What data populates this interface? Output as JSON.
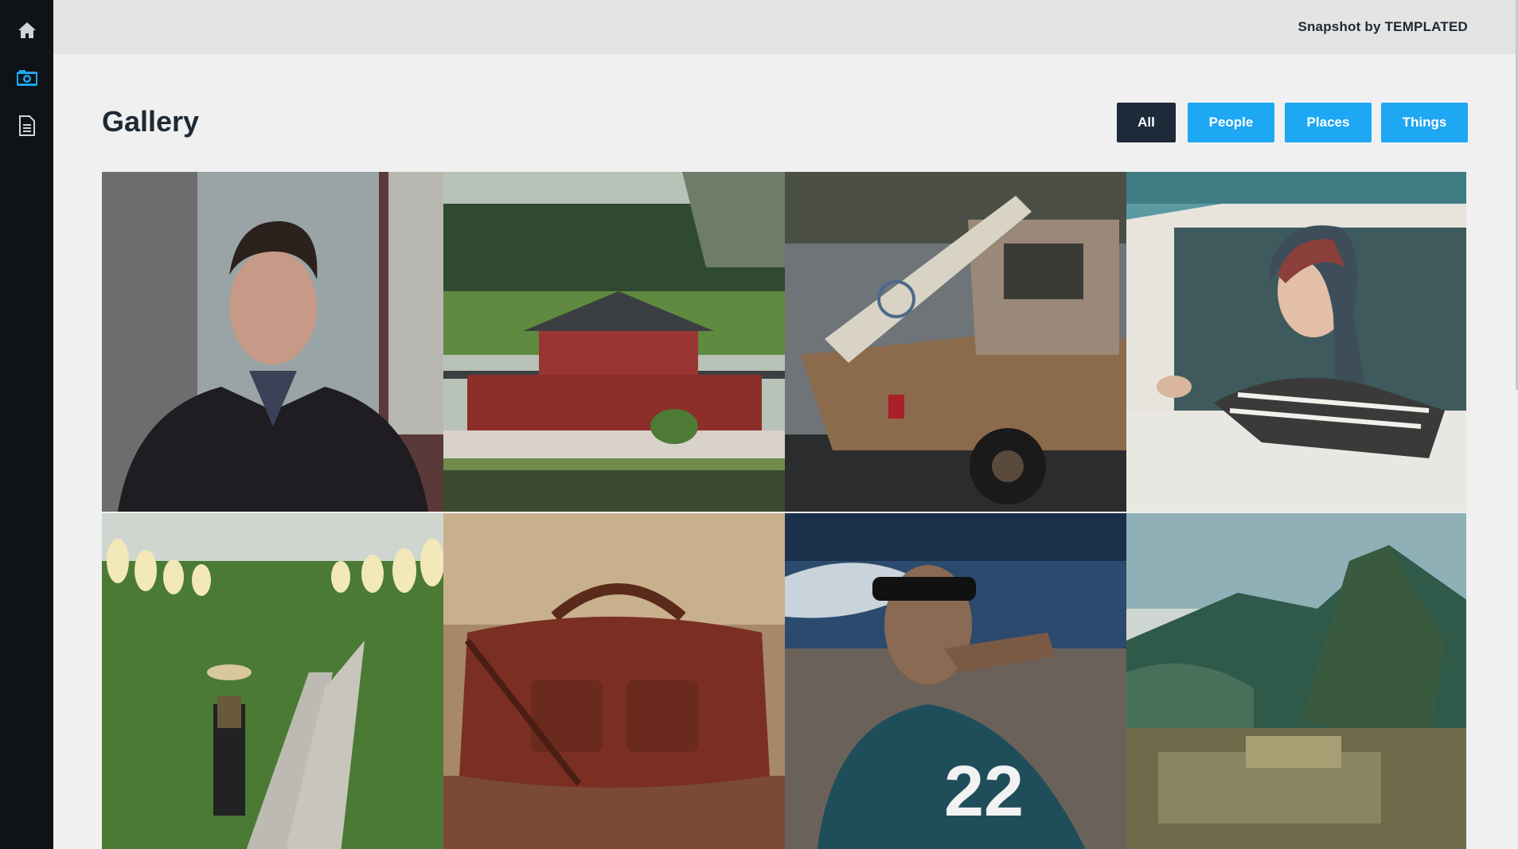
{
  "sidebar": {
    "items": [
      {
        "icon": "home-icon",
        "active": false
      },
      {
        "icon": "camera-icon",
        "active": true
      },
      {
        "icon": "document-icon",
        "active": false
      }
    ]
  },
  "header": {
    "brand": "Snapshot by TEMPLATED"
  },
  "main": {
    "title": "Gallery",
    "filters": [
      {
        "label": "All",
        "active": true
      },
      {
        "label": "People",
        "active": false
      },
      {
        "label": "Places",
        "active": false
      },
      {
        "label": "Things",
        "active": false
      }
    ],
    "photos": [
      {
        "subject": "portrait of man in dark blazer"
      },
      {
        "subject": "red japanese temple with pond and forest"
      },
      {
        "subject": "rusty vintage pickup truck with surfboard"
      },
      {
        "subject": "woman with headscarf in teal car window"
      },
      {
        "subject": "woman walking garden path under paper lanterns"
      },
      {
        "subject": "brown leather duffel bag"
      },
      {
        "subject": "man in sunglasses smoking, jersey 22"
      },
      {
        "subject": "machu picchu mountain ruins"
      }
    ]
  },
  "colors": {
    "sidebar_bg": "#0e1318",
    "accent": "#1ea7f2",
    "active_filter": "#1c2a39",
    "topbar_bg": "#e4e4e4",
    "page_bg": "#f0f0f0"
  }
}
